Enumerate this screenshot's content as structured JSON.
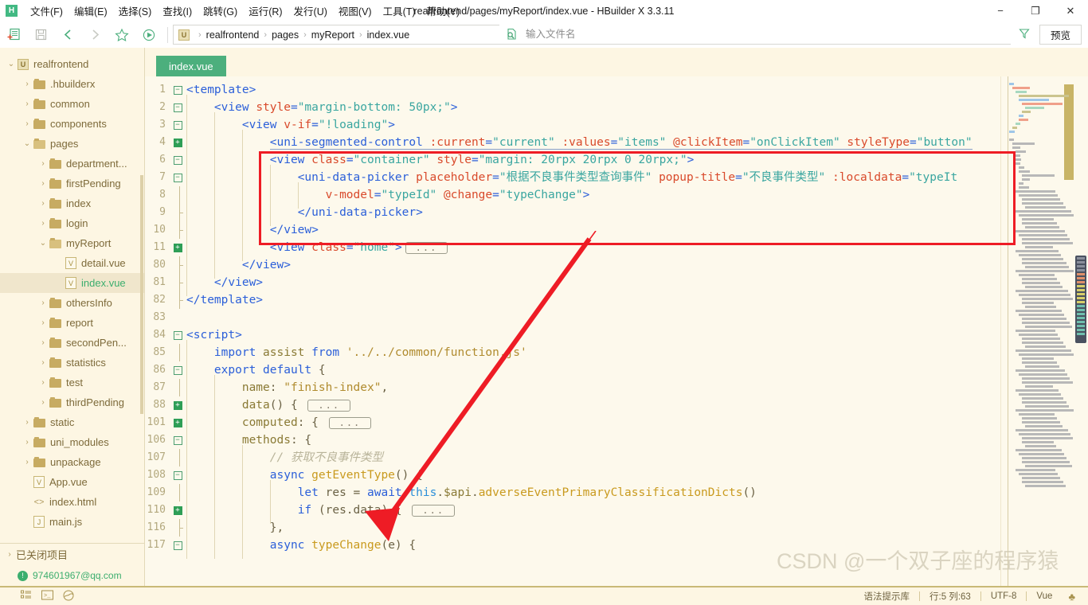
{
  "window": {
    "title": "realfrontend/pages/myReport/index.vue - HBuilder X 3.3.11",
    "logo": "H",
    "minimize": "−",
    "maximize": "❐",
    "close": "✕"
  },
  "menubar": {
    "items": [
      {
        "label": "文件(F)",
        "name": "menu-file"
      },
      {
        "label": "编辑(E)",
        "name": "menu-edit"
      },
      {
        "label": "选择(S)",
        "name": "menu-select"
      },
      {
        "label": "查找(I)",
        "name": "menu-find"
      },
      {
        "label": "跳转(G)",
        "name": "menu-goto"
      },
      {
        "label": "运行(R)",
        "name": "menu-run"
      },
      {
        "label": "发行(U)",
        "name": "menu-publish"
      },
      {
        "label": "视图(V)",
        "name": "menu-view"
      },
      {
        "label": "工具(T)",
        "name": "menu-tools"
      },
      {
        "label": "帮助(Y)",
        "name": "menu-help"
      }
    ]
  },
  "toolbar": {
    "icons": [
      {
        "name": "new-file-icon",
        "glyph": "▤"
      },
      {
        "name": "save-icon",
        "glyph": "▯"
      },
      {
        "name": "back-icon",
        "glyph": "❮"
      },
      {
        "name": "forward-icon",
        "glyph": "❯"
      },
      {
        "name": "favorite-star-icon",
        "glyph": "☆"
      },
      {
        "name": "run-icon",
        "glyph": "▶"
      }
    ],
    "breadcrumb": {
      "badge": "U",
      "parts": [
        "realfrontend",
        "pages",
        "myReport",
        "index.vue"
      ],
      "separator": "›"
    },
    "filename_placeholder": "输入文件名",
    "filename_value": "",
    "filter_icon": "▽",
    "preview_label": "预览"
  },
  "sidebar": {
    "tree": [
      {
        "indent": 0,
        "twisty": "⌄",
        "icon": "project-badge",
        "icon_glyph": "U",
        "label": "realfrontend",
        "selected": false
      },
      {
        "indent": 1,
        "twisty": "›",
        "icon": "folder",
        "label": ".hbuilderx",
        "selected": false
      },
      {
        "indent": 1,
        "twisty": "›",
        "icon": "folder",
        "label": "common",
        "selected": false
      },
      {
        "indent": 1,
        "twisty": "›",
        "icon": "folder",
        "label": "components",
        "selected": false
      },
      {
        "indent": 1,
        "twisty": "⌄",
        "icon": "folder-open",
        "label": "pages",
        "selected": false
      },
      {
        "indent": 2,
        "twisty": "›",
        "icon": "folder",
        "label": "department...",
        "selected": false
      },
      {
        "indent": 2,
        "twisty": "›",
        "icon": "folder",
        "label": "firstPending",
        "selected": false
      },
      {
        "indent": 2,
        "twisty": "›",
        "icon": "folder",
        "label": "index",
        "selected": false
      },
      {
        "indent": 2,
        "twisty": "›",
        "icon": "folder",
        "label": "login",
        "selected": false
      },
      {
        "indent": 2,
        "twisty": "⌄",
        "icon": "folder-open",
        "label": "myReport",
        "selected": false
      },
      {
        "indent": 3,
        "twisty": "",
        "icon": "vue-file",
        "icon_glyph": "V",
        "label": "detail.vue",
        "selected": false
      },
      {
        "indent": 3,
        "twisty": "",
        "icon": "vue-file",
        "icon_glyph": "V",
        "label": "index.vue",
        "selected": true
      },
      {
        "indent": 2,
        "twisty": "›",
        "icon": "folder",
        "label": "othersInfo",
        "selected": false
      },
      {
        "indent": 2,
        "twisty": "›",
        "icon": "folder",
        "label": "report",
        "selected": false
      },
      {
        "indent": 2,
        "twisty": "›",
        "icon": "folder",
        "label": "secondPen...",
        "selected": false
      },
      {
        "indent": 2,
        "twisty": "›",
        "icon": "folder",
        "label": "statistics",
        "selected": false
      },
      {
        "indent": 2,
        "twisty": "›",
        "icon": "folder",
        "label": "test",
        "selected": false
      },
      {
        "indent": 2,
        "twisty": "›",
        "icon": "folder",
        "label": "thirdPending",
        "selected": false
      },
      {
        "indent": 1,
        "twisty": "›",
        "icon": "folder",
        "label": "static",
        "selected": false
      },
      {
        "indent": 1,
        "twisty": "›",
        "icon": "folder",
        "label": "uni_modules",
        "selected": false
      },
      {
        "indent": 1,
        "twisty": "›",
        "icon": "folder",
        "label": "unpackage",
        "selected": false
      },
      {
        "indent": 1,
        "twisty": "",
        "icon": "vue-file",
        "icon_glyph": "V",
        "label": "App.vue",
        "selected": false
      },
      {
        "indent": 1,
        "twisty": "",
        "icon": "html-file",
        "icon_glyph": "<>",
        "label": "index.html",
        "selected": false
      },
      {
        "indent": 1,
        "twisty": "",
        "icon": "js-file",
        "icon_glyph": "J",
        "label": "main.js",
        "selected": false
      }
    ],
    "closed_projects": {
      "twisty": "›",
      "label": "已关闭项目"
    },
    "account": {
      "label": "974601967@qq.com",
      "badge": "!"
    }
  },
  "editor": {
    "tab": {
      "label": "index.vue",
      "active": true
    },
    "lines": [
      {
        "n": "1",
        "fold": "minus",
        "bars": 0,
        "indent": 0,
        "tokens": [
          {
            "c": "t-tag",
            "t": "<template>"
          }
        ]
      },
      {
        "n": "2",
        "fold": "minus",
        "bars": 0,
        "indent": 1,
        "tokens": [
          {
            "c": "t-tag",
            "t": "<view "
          },
          {
            "c": "t-attr",
            "t": "style"
          },
          {
            "c": "t-punct",
            "t": "="
          },
          {
            "c": "t-str",
            "t": "\"margin-bottom: 50px;\""
          },
          {
            "c": "t-tag",
            "t": ">"
          }
        ]
      },
      {
        "n": "3",
        "fold": "minus",
        "bars": 0,
        "indent": 2,
        "tokens": [
          {
            "c": "t-tag",
            "t": "<view "
          },
          {
            "c": "t-attr",
            "t": "v-if"
          },
          {
            "c": "t-punct",
            "t": "="
          },
          {
            "c": "t-str",
            "t": "\"!loading\""
          },
          {
            "c": "t-tag",
            "t": ">"
          }
        ]
      },
      {
        "n": "4",
        "fold": "plus",
        "bars": 0,
        "indent": 3,
        "underline": true,
        "tokens": [
          {
            "c": "t-tag",
            "t": "<uni-segmented-control "
          },
          {
            "c": "t-attr",
            "t": ":current"
          },
          {
            "c": "t-punct",
            "t": "="
          },
          {
            "c": "t-str",
            "t": "\"current\" "
          },
          {
            "c": "t-attr",
            "t": ":values"
          },
          {
            "c": "t-punct",
            "t": "="
          },
          {
            "c": "t-str",
            "t": "\"items\" "
          },
          {
            "c": "t-attr",
            "t": "@clickItem"
          },
          {
            "c": "t-punct",
            "t": "="
          },
          {
            "c": "t-str",
            "t": "\"onClickItem\" "
          },
          {
            "c": "t-attr",
            "t": "styleType"
          },
          {
            "c": "t-punct",
            "t": "="
          },
          {
            "c": "t-str",
            "t": "\"button\""
          }
        ]
      },
      {
        "n": "6",
        "fold": "minus",
        "bars": 0,
        "indent": 3,
        "tokens": [
          {
            "c": "t-tag",
            "t": "<view "
          },
          {
            "c": "t-attr",
            "t": "class"
          },
          {
            "c": "t-punct",
            "t": "="
          },
          {
            "c": "t-str",
            "t": "\"container\" "
          },
          {
            "c": "t-attr",
            "t": "style"
          },
          {
            "c": "t-punct",
            "t": "="
          },
          {
            "c": "t-str",
            "t": "\"margin: 20rpx 20rpx 0 20rpx;\""
          },
          {
            "c": "t-tag",
            "t": ">"
          }
        ]
      },
      {
        "n": "7",
        "fold": "minus",
        "bars": 0,
        "indent": 4,
        "tokens": [
          {
            "c": "t-tag",
            "t": "<uni-data-picker "
          },
          {
            "c": "t-attr",
            "t": "placeholder"
          },
          {
            "c": "t-punct",
            "t": "="
          },
          {
            "c": "t-str",
            "t": "\"根据不良事件类型查询事件\" "
          },
          {
            "c": "t-attr",
            "t": "popup-title"
          },
          {
            "c": "t-punct",
            "t": "="
          },
          {
            "c": "t-str",
            "t": "\"不良事件类型\" "
          },
          {
            "c": "t-attr",
            "t": ":localdata"
          },
          {
            "c": "t-punct",
            "t": "="
          },
          {
            "c": "t-str",
            "t": "\"typeIt"
          }
        ]
      },
      {
        "n": "8",
        "fold": "bar",
        "bars": 0,
        "indent": 5,
        "tokens": [
          {
            "c": "t-attr",
            "t": "v-model"
          },
          {
            "c": "t-punct",
            "t": "="
          },
          {
            "c": "t-str",
            "t": "\"typeId\" "
          },
          {
            "c": "t-attr",
            "t": "@change"
          },
          {
            "c": "t-punct",
            "t": "="
          },
          {
            "c": "t-str",
            "t": "\"typeChange\""
          },
          {
            "c": "t-tag",
            "t": ">"
          }
        ]
      },
      {
        "n": "9",
        "fold": "barend",
        "bars": 0,
        "indent": 4,
        "tokens": [
          {
            "c": "t-tag",
            "t": "</uni-data-picker>"
          }
        ]
      },
      {
        "n": "10",
        "fold": "barend",
        "bars": 0,
        "indent": 3,
        "tokens": [
          {
            "c": "t-tag",
            "t": "</view>"
          }
        ]
      },
      {
        "n": "11",
        "fold": "plus",
        "bars": 0,
        "indent": 3,
        "tokens": [
          {
            "c": "t-tag",
            "t": "<view "
          },
          {
            "c": "t-attr",
            "t": "class"
          },
          {
            "c": "t-punct",
            "t": "="
          },
          {
            "c": "t-str",
            "t": "\"home\""
          },
          {
            "c": "t-tag",
            "t": ">"
          }
        ],
        "collapsed": "..."
      },
      {
        "n": "80",
        "fold": "barend",
        "bars": 0,
        "indent": 2,
        "tokens": [
          {
            "c": "t-tag",
            "t": "</view>"
          }
        ]
      },
      {
        "n": "81",
        "fold": "barend",
        "bars": 0,
        "indent": 1,
        "tokens": [
          {
            "c": "t-tag",
            "t": "</view>"
          }
        ]
      },
      {
        "n": "82",
        "fold": "barend",
        "bars": 0,
        "indent": 0,
        "tokens": [
          {
            "c": "t-tag",
            "t": "</template>"
          }
        ]
      },
      {
        "n": "83",
        "fold": "",
        "bars": 0,
        "indent": 0,
        "tokens": []
      },
      {
        "n": "84",
        "fold": "minus",
        "bars": 0,
        "indent": 0,
        "tokens": [
          {
            "c": "t-tag",
            "t": "<script>"
          }
        ]
      },
      {
        "n": "85",
        "fold": "bar",
        "bars": 0,
        "indent": 1,
        "tokens": [
          {
            "c": "t-kw",
            "t": "import "
          },
          {
            "c": "t-id",
            "t": "assist "
          },
          {
            "c": "t-kw",
            "t": "from "
          },
          {
            "c": "t-strv",
            "t": "'../../common/function.js'"
          }
        ]
      },
      {
        "n": "86",
        "fold": "minus",
        "bars": 0,
        "indent": 1,
        "tokens": [
          {
            "c": "t-kw",
            "t": "export default "
          },
          {
            "c": "t-plain",
            "t": "{"
          }
        ]
      },
      {
        "n": "87",
        "fold": "bar",
        "bars": 0,
        "indent": 2,
        "tokens": [
          {
            "c": "t-prop",
            "t": "name"
          },
          {
            "c": "t-plain",
            "t": ": "
          },
          {
            "c": "t-strv",
            "t": "\"finish-index\""
          },
          {
            "c": "t-plain",
            "t": ","
          }
        ]
      },
      {
        "n": "88",
        "fold": "plus",
        "bars": 0,
        "indent": 2,
        "tokens": [
          {
            "c": "t-prop",
            "t": "data"
          },
          {
            "c": "t-plain",
            "t": "() { "
          }
        ],
        "collapsed": "..."
      },
      {
        "n": "101",
        "fold": "plus",
        "bars": 0,
        "indent": 2,
        "tokens": [
          {
            "c": "t-prop",
            "t": "computed"
          },
          {
            "c": "t-plain",
            "t": ": { "
          }
        ],
        "collapsed": "..."
      },
      {
        "n": "106",
        "fold": "minus",
        "bars": 0,
        "indent": 2,
        "tokens": [
          {
            "c": "t-prop",
            "t": "methods"
          },
          {
            "c": "t-plain",
            "t": ": {"
          }
        ]
      },
      {
        "n": "107",
        "fold": "bar",
        "bars": 0,
        "indent": 3,
        "tokens": [
          {
            "c": "t-cmt",
            "t": "// 获取不良事件类型"
          }
        ]
      },
      {
        "n": "108",
        "fold": "minus",
        "bars": 0,
        "indent": 3,
        "tokens": [
          {
            "c": "t-kw",
            "t": "async "
          },
          {
            "c": "t-fn",
            "t": "getEventType"
          },
          {
            "c": "t-plain",
            "t": "() {"
          }
        ]
      },
      {
        "n": "109",
        "fold": "bar",
        "bars": 0,
        "indent": 4,
        "tokens": [
          {
            "c": "t-kw",
            "t": "let "
          },
          {
            "c": "t-plain",
            "t": "res = "
          },
          {
            "c": "t-kw",
            "t": "await "
          },
          {
            "c": "t-this",
            "t": "this"
          },
          {
            "c": "t-plain",
            "t": "."
          },
          {
            "c": "t-id",
            "t": "$api"
          },
          {
            "c": "t-plain",
            "t": "."
          },
          {
            "c": "t-fn",
            "t": "adverseEventPrimaryClassificationDicts"
          },
          {
            "c": "t-plain",
            "t": "()"
          }
        ]
      },
      {
        "n": "110",
        "fold": "plus",
        "bars": 0,
        "indent": 4,
        "tokens": [
          {
            "c": "t-kw",
            "t": "if "
          },
          {
            "c": "t-plain",
            "t": "(res.data) { "
          }
        ],
        "collapsed": "..."
      },
      {
        "n": "116",
        "fold": "barend",
        "bars": 0,
        "indent": 3,
        "tokens": [
          {
            "c": "t-plain",
            "t": "},"
          }
        ]
      },
      {
        "n": "117",
        "fold": "minus",
        "bars": 0,
        "indent": 3,
        "tokens": [
          {
            "c": "t-kw",
            "t": "async "
          },
          {
            "c": "t-fn",
            "t": "typeChange"
          },
          {
            "c": "t-plain",
            "t": "(e) {"
          }
        ]
      }
    ]
  },
  "statusbar": {
    "left_icons": [
      {
        "name": "outline-icon",
        "glyph": "☰"
      },
      {
        "name": "terminal-icon",
        "glyph": "▣"
      },
      {
        "name": "browser-icon",
        "glyph": "◍"
      }
    ],
    "right_items": [
      "语法提示库",
      "行:5  列:63",
      "UTF-8",
      "Vue"
    ],
    "notify_icon": "♣"
  },
  "annotations": {
    "watermark": "CSDN @一个双子座的程序猿",
    "highlight_color": "#ee1c25"
  },
  "colors": {
    "editor_bg": "#fdf9ec",
    "sidebar_bg": "#fdf6e3",
    "accent_green": "#4caf7d",
    "tab_active_bg": "#4caf7d",
    "annotation_red": "#ee1c25"
  }
}
